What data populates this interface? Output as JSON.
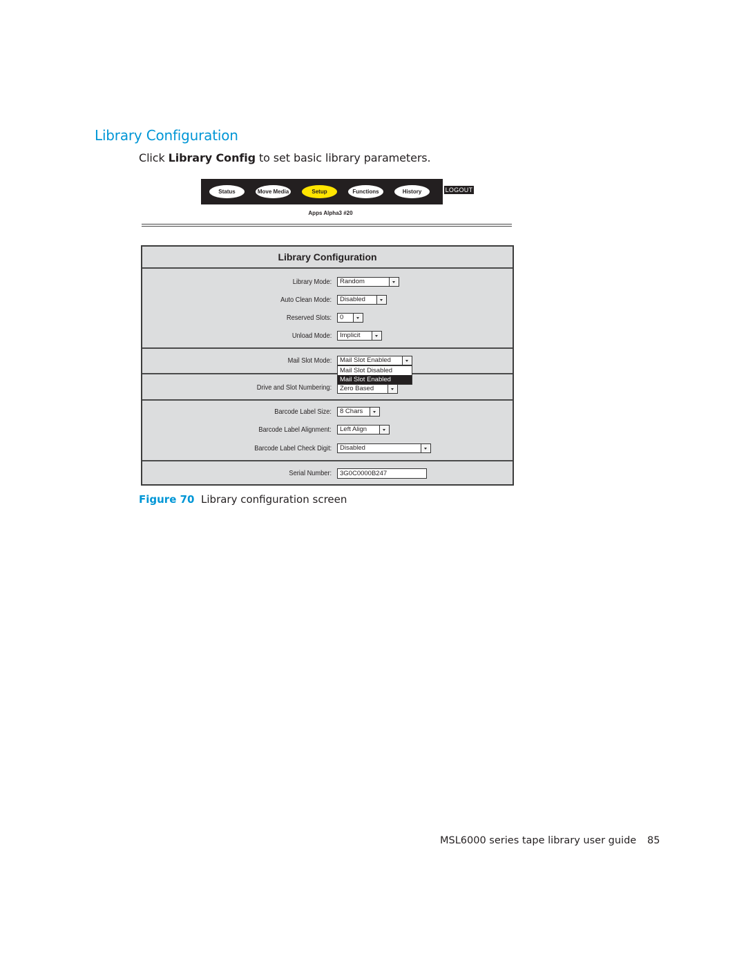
{
  "section": {
    "title": "Library Configuration",
    "intro_prefix": "Click ",
    "intro_bold": "Library Config",
    "intro_suffix": " to set basic library parameters."
  },
  "nav": {
    "tabs": [
      {
        "label": "Status",
        "active": false
      },
      {
        "label": "Move Media",
        "active": false
      },
      {
        "label": "Setup",
        "active": true
      },
      {
        "label": "Functions",
        "active": false
      },
      {
        "label": "History",
        "active": false
      }
    ],
    "logout_label": "LOGOUT",
    "device_label": "Apps Alpha3 #20",
    "active_color": "#ffe500"
  },
  "panel": {
    "title": "Library Configuration",
    "fields": {
      "library_mode": {
        "label": "Library  Mode:",
        "value": "Random"
      },
      "auto_clean_mode": {
        "label": "Auto Clean Mode:",
        "value": "Disabled"
      },
      "reserved_slots": {
        "label": "Reserved Slots:",
        "value": "0"
      },
      "unload_mode": {
        "label": "Unload Mode:",
        "value": "Implicit"
      },
      "mail_slot_mode": {
        "label": "Mail Slot Mode:",
        "value": "Mail Slot Enabled",
        "options": [
          "Mail Slot Disabled",
          "Mail Slot Enabled"
        ],
        "highlighted_option": "Mail Slot Enabled"
      },
      "drive_slot_numbering": {
        "label": "Drive and Slot Numbering:",
        "value": "Zero Based"
      },
      "barcode_label_size": {
        "label": "Barcode Label Size:",
        "value": "8 Chars"
      },
      "barcode_label_alignment": {
        "label": "Barcode Label Alignment:",
        "value": "Left Align"
      },
      "barcode_label_check_digit": {
        "label": "Barcode Label Check Digit:",
        "value": "Disabled"
      },
      "serial_number": {
        "label": "Serial Number:",
        "value": "3G0C0000B247"
      }
    }
  },
  "caption": {
    "figure_label": "Figure 70",
    "text": "  Library configuration screen"
  },
  "footer": {
    "guide_title": "MSL6000 series tape library user guide",
    "page_number": "85"
  },
  "colors": {
    "accent_blue": "#0096d6",
    "panel_bg": "#dcddde",
    "nav_bg": "#231f20"
  }
}
